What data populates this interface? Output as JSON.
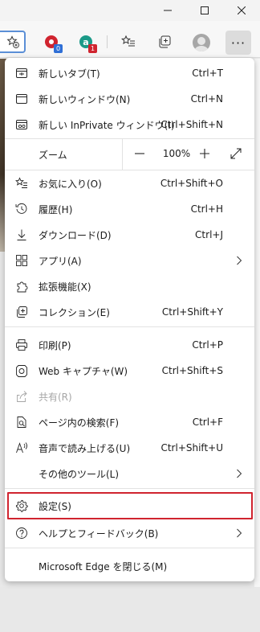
{
  "window": {
    "minimize_icon": "minimize-icon",
    "maximize_icon": "maximize-icon",
    "close_icon": "close-icon"
  },
  "toolbar": {
    "favorites_add_icon": "star-add-icon",
    "ext1_badge": "0",
    "ext2_badge": "1",
    "favorites_icon": "favorites-icon",
    "collections_icon": "collections-icon",
    "more_label": "···"
  },
  "menu": {
    "new_tab": {
      "label": "新しいタブ(T)",
      "shortcut": "Ctrl+T"
    },
    "new_window": {
      "label": "新しいウィンドウ(N)",
      "shortcut": "Ctrl+N"
    },
    "new_inprivate": {
      "label": "新しい InPrivate ウィンドウ(I)",
      "shortcut": "Ctrl+Shift+N"
    },
    "zoom": {
      "label": "ズーム",
      "minus": "—",
      "value": "100%",
      "plus": "+"
    },
    "favorites": {
      "label": "お気に入り(O)",
      "shortcut": "Ctrl+Shift+O"
    },
    "history": {
      "label": "履歴(H)",
      "shortcut": "Ctrl+H"
    },
    "downloads": {
      "label": "ダウンロード(D)",
      "shortcut": "Ctrl+J"
    },
    "apps": {
      "label": "アプリ(A)"
    },
    "extensions": {
      "label": "拡張機能(X)"
    },
    "collections": {
      "label": "コレクション(E)",
      "shortcut": "Ctrl+Shift+Y"
    },
    "print": {
      "label": "印刷(P)",
      "shortcut": "Ctrl+P"
    },
    "web_capture": {
      "label": "Web キャプチャ(W)",
      "shortcut": "Ctrl+Shift+S"
    },
    "share": {
      "label": "共有(R)"
    },
    "find": {
      "label": "ページ内の検索(F)",
      "shortcut": "Ctrl+F"
    },
    "read_aloud": {
      "label": "音声で読み上げる(U)",
      "shortcut": "Ctrl+Shift+U"
    },
    "more_tools": {
      "label": "その他のツール(L)"
    },
    "settings": {
      "label": "設定(S)"
    },
    "help": {
      "label": "ヘルプとフィードバック(B)"
    },
    "close_edge": {
      "label": "Microsoft Edge を閉じる(M)"
    }
  },
  "colors": {
    "highlight": "#d0242f",
    "ext1": "#d0242f",
    "ext2": "#1b9a88",
    "badge_blue": "#2f6fd6",
    "badge_red": "#d0242f"
  }
}
